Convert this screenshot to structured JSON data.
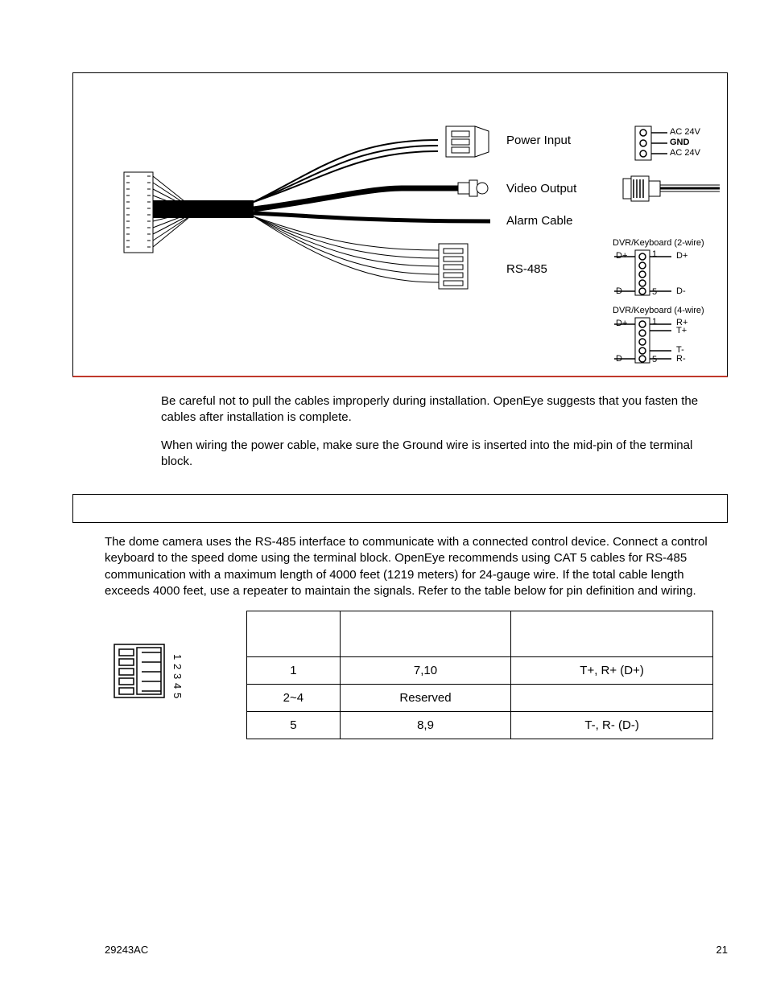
{
  "diagram": {
    "labels": {
      "power_input": "Power Input",
      "video_output": "Video Output",
      "alarm_cable": "Alarm Cable",
      "rs485": "RS-485"
    },
    "terminal": {
      "ac24_top": "AC 24V",
      "gnd": "GND",
      "ac24_bot": "AC 24V"
    },
    "rs485_2wire": {
      "title": "DVR/Keyboard (2-wire)",
      "left_top": "D+",
      "left_bot": "D-",
      "right_top": "D+",
      "right_bot": "D-",
      "pin1": "1",
      "pin5": "5"
    },
    "rs485_4wire": {
      "title": "DVR/Keyboard (4-wire)",
      "left_top": "D+",
      "left_bot": "D-",
      "right_r_plus": "R+",
      "right_t_plus": "T+",
      "right_t_minus": "T-",
      "right_r_minus": "R-",
      "pin1": "1",
      "pin5": "5"
    }
  },
  "paragraphs": {
    "p1": "Be careful not to pull the cables improperly during installation.  OpenEye suggests that you fasten the cables after installation is complete.",
    "p2": "When wiring the power cable, make sure the Ground wire is inserted into the mid-pin of the terminal block.",
    "p3": "The dome camera uses the RS-485 interface to communicate with a connected control device.  Connect a control keyboard to the speed dome using the terminal block.  OpenEye recommends using CAT 5 cables for RS-485 communication with a maximum length of 4000 feet (1219 meters) for 24-gauge wire.  If the total cable length exceeds 4000 feet, use a repeater to maintain the signals.  Refer to the table below for pin definition and wiring."
  },
  "pin_numbers": [
    "1",
    "2",
    "3",
    "4",
    "5"
  ],
  "table": {
    "headers": [
      "",
      "",
      ""
    ],
    "rows": [
      [
        "1",
        "7,10",
        "T+, R+ (D+)"
      ],
      [
        "2~4",
        "Reserved",
        ""
      ],
      [
        "5",
        "8,9",
        "T-, R- (D-)"
      ]
    ]
  },
  "footer": {
    "left": "29243AC",
    "right": "21"
  }
}
